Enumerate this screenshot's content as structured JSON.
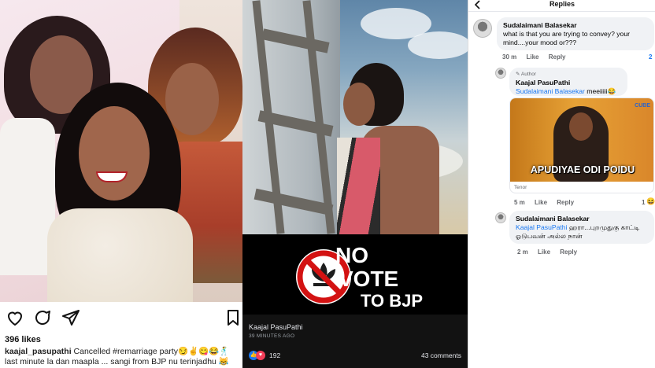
{
  "instagram": {
    "likes": "396 likes",
    "username": "kaajal_pasupathi",
    "caption_part1": "Cancelled #remarriage party",
    "caption_emojis": "😏✌😋😂🕺",
    "caption_part2": "last minute la dan maapla ... sangi from BJP nu terinjadhu",
    "caption_end_emoji": "😹"
  },
  "facebook_post": {
    "banner_line1": "NO",
    "banner_line2": "VOTE",
    "banner_line3": "TO BJP",
    "author": "Kaajal PasuPathi",
    "time": "39 MINUTES AGO",
    "reactions_count": "192",
    "comments_count": "43 comments",
    "colors": {
      "like": "#1877f2",
      "love": "#f33e58",
      "ban_red": "#d31212"
    }
  },
  "replies_panel": {
    "title": "Replies",
    "back_icon": "back-arrow-icon",
    "comment1": {
      "name": "Sudalaimani Balasekar",
      "text": "what is that you are trying to convey? your mind....your mood or???",
      "time": "30 m",
      "like": "Like",
      "reply": "Reply",
      "count": "2"
    },
    "comment2": {
      "badge": "Author",
      "name": "Kaajal PasuPathi",
      "tag": "Sudalaimani Balasekar",
      "text": "meeiiiii😂",
      "gif_text": "APUDIYAE ODI POIDU",
      "gif_logo": "CUBE",
      "gif_source": "Tenor",
      "time": "5 m",
      "like": "Like",
      "reply": "Reply",
      "count": "1"
    },
    "comment3": {
      "name": "Sudalaimani Balasekar",
      "tag": "Kaajal PasuPathi",
      "text": "ஹரா...புறமுதுகு காட்டி ஓடுபவன் அல்ல நான்",
      "time": "2 m",
      "like": "Like",
      "reply": "Reply"
    }
  }
}
